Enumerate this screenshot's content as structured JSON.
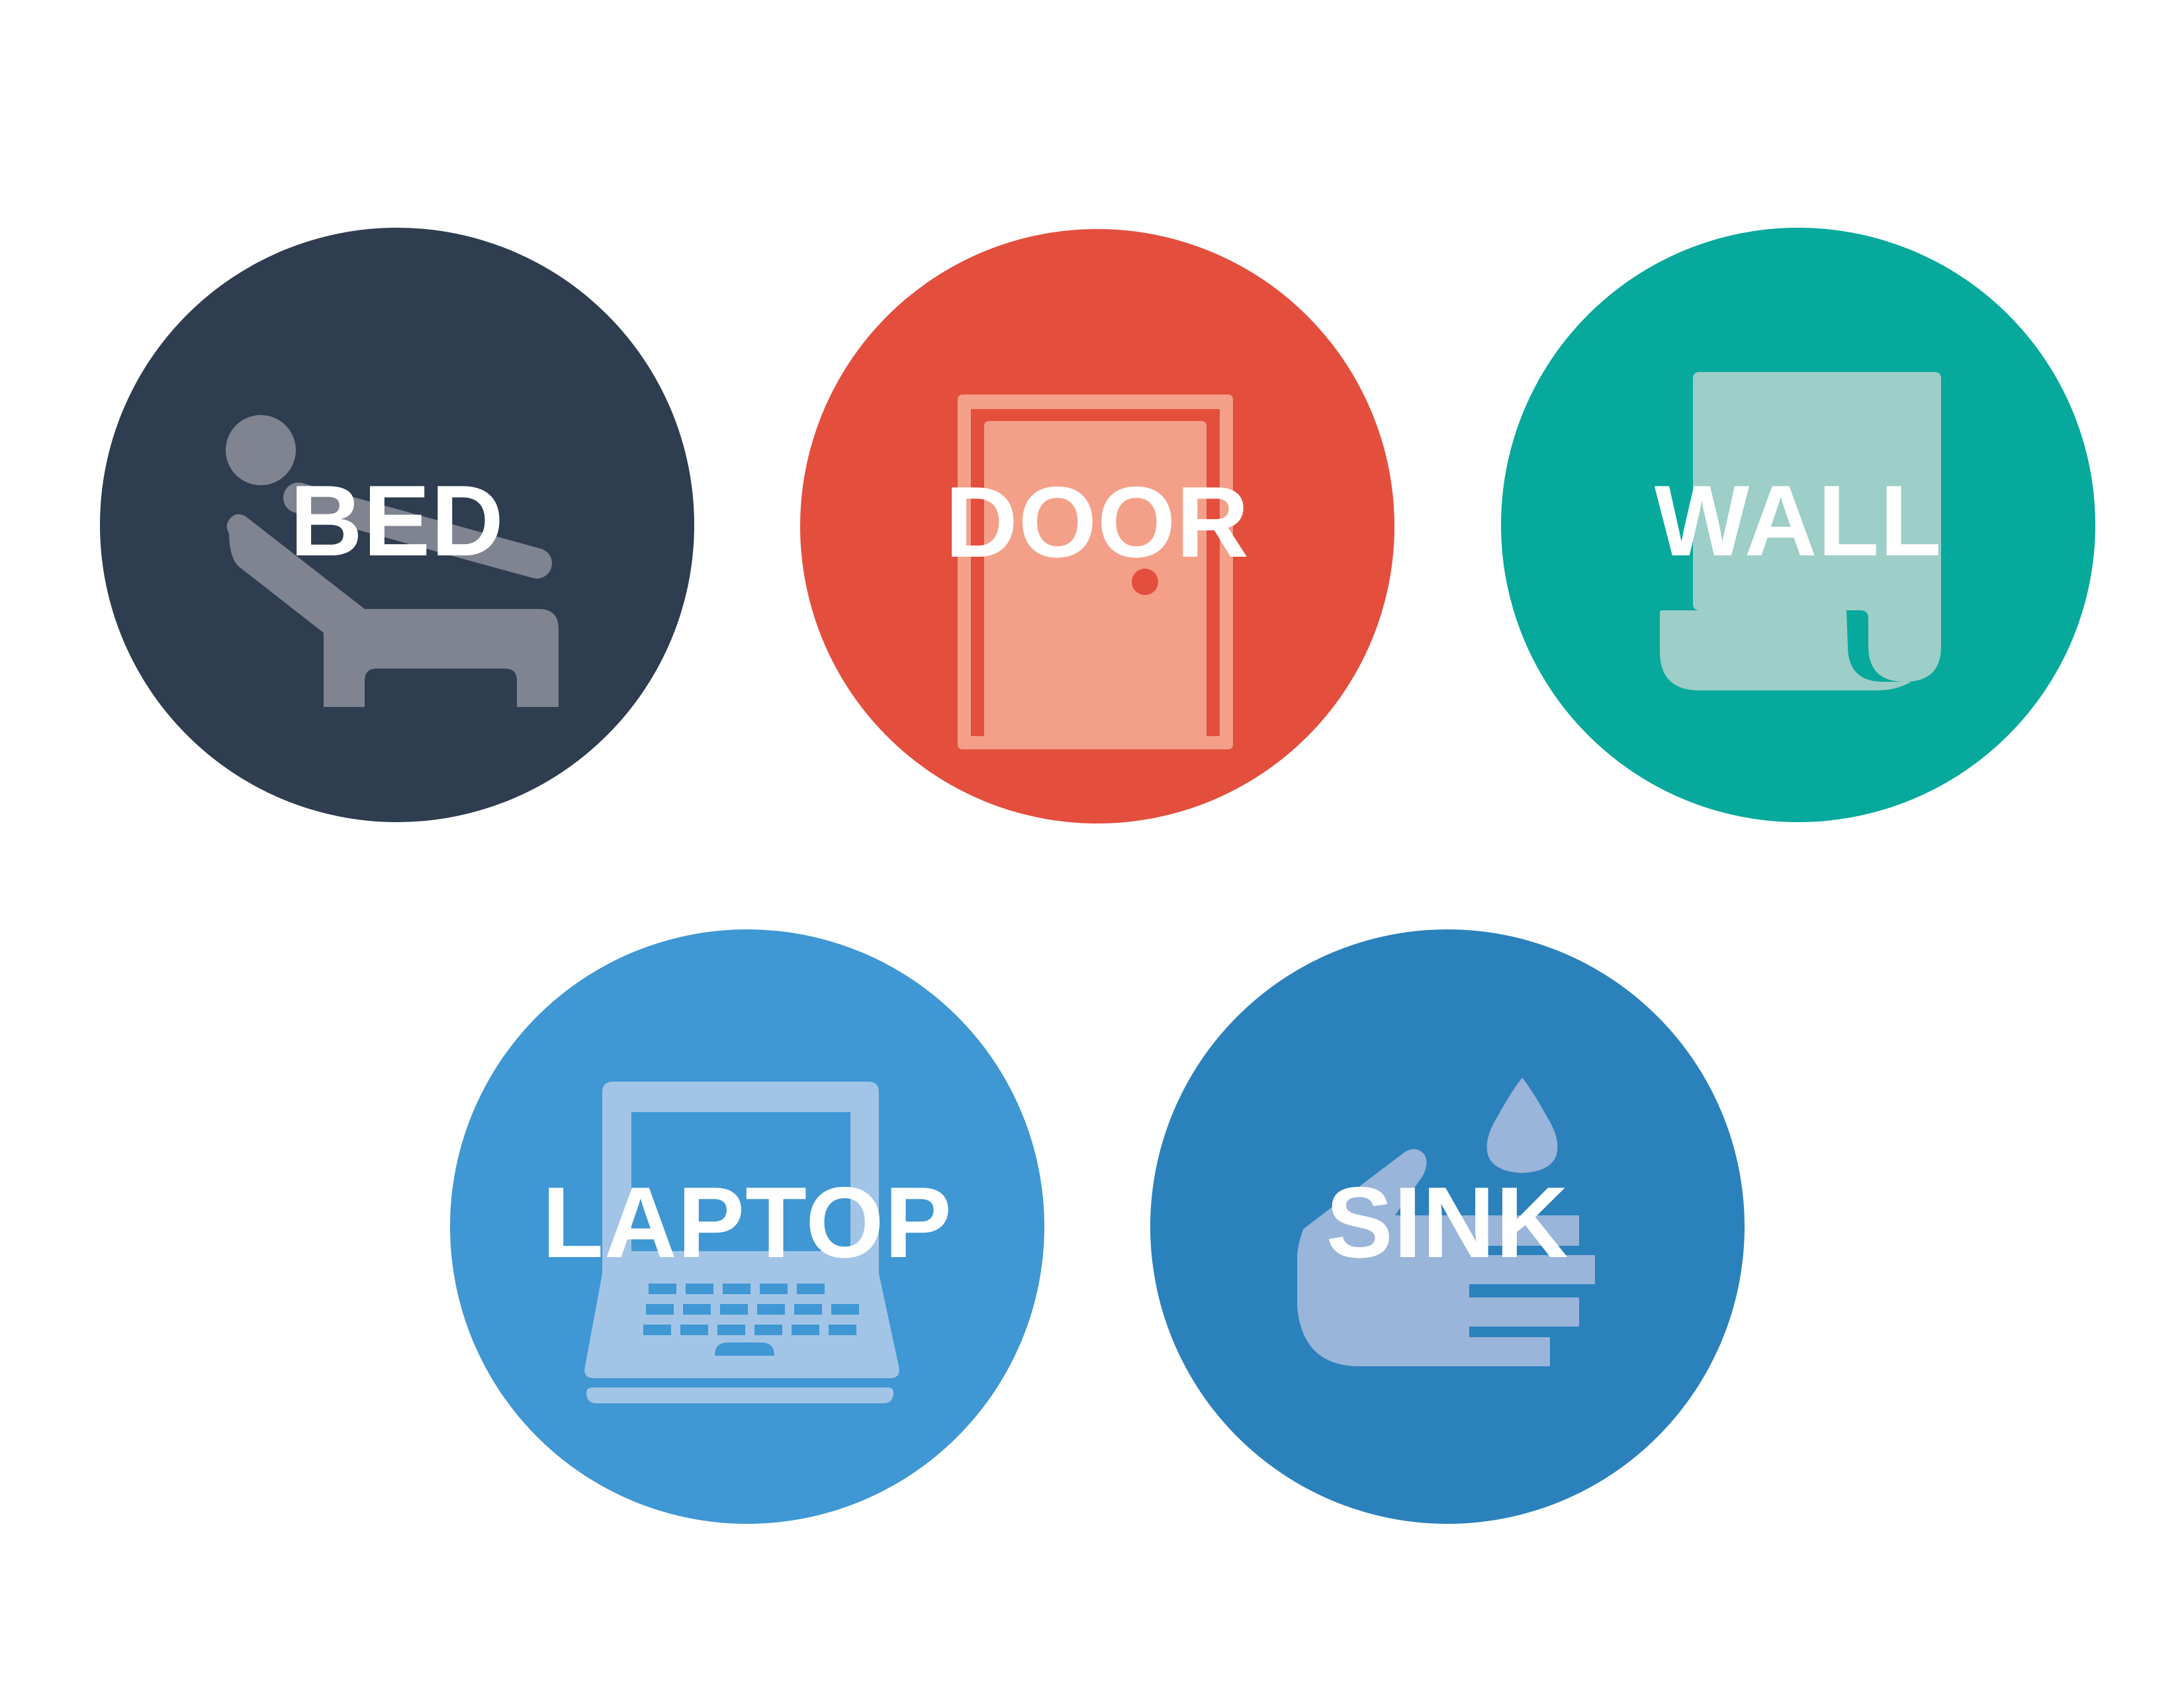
{
  "tiles": [
    {
      "id": "bed",
      "label": "BED",
      "icon": "reclining-person-bed-icon",
      "color": "#2e3d50",
      "icon_color": "#7f8490"
    },
    {
      "id": "door",
      "label": "DOOR",
      "icon": "door-icon",
      "color": "#e44e3d",
      "icon_color": "#f4a088"
    },
    {
      "id": "wall",
      "label": "WALL",
      "icon": "wallpaper-roll-icon",
      "color": "#06a99c",
      "icon_color": "#9dcec7"
    },
    {
      "id": "laptop",
      "label": "LAPTOP",
      "icon": "laptop-icon",
      "color": "#3f97d3",
      "icon_color": "#a2c5e7"
    },
    {
      "id": "sink",
      "label": "SINK",
      "icon": "hand-washing-icon",
      "color": "#2b81bc",
      "icon_color": "#99b5d9"
    }
  ]
}
